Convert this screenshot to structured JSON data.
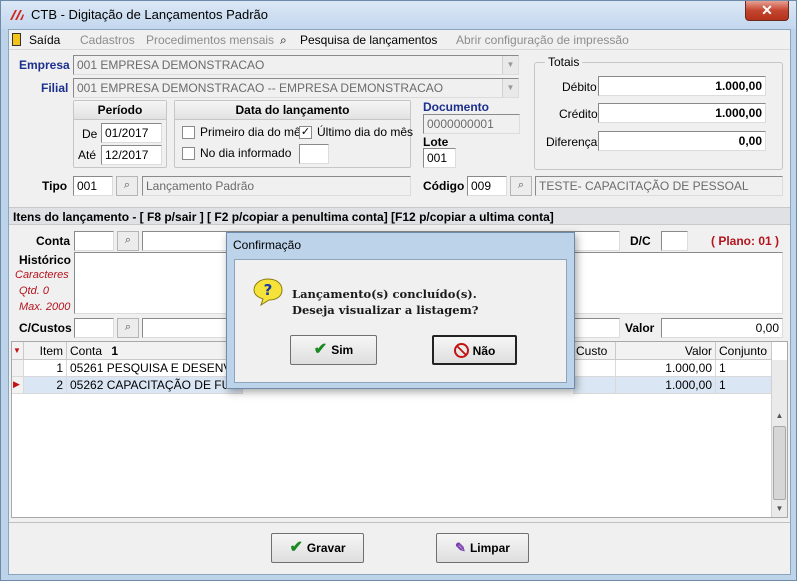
{
  "window": {
    "title": "CTB - Digitação de Lançamentos Padrão",
    "close": "✕"
  },
  "menu": [
    {
      "label": "Saída",
      "enabled": true
    },
    {
      "label": "Cadastros",
      "enabled": false
    },
    {
      "label": "Procedimentos mensais",
      "enabled": false
    },
    {
      "label": "Pesquisa de lançamentos",
      "enabled": true
    },
    {
      "label": "Abrir configuração de impressão",
      "enabled": false
    }
  ],
  "empresa": {
    "label": "Empresa",
    "value": "001 EMPRESA DEMONSTRACAO"
  },
  "filial": {
    "label": "Filial",
    "value": "001 EMPRESA DEMONSTRACAO -- EMPRESA DEMONSTRACAO"
  },
  "periodo": {
    "title": "Período",
    "de_label": "De",
    "de": "01/2017",
    "ate_label": "Até",
    "ate": "12/2017"
  },
  "data_lancamento": {
    "title": "Data do lançamento",
    "primeiro": {
      "label": "Primeiro dia do mês",
      "checked": false
    },
    "ultimo": {
      "label": "Último dia do mês",
      "checked": true
    },
    "no_dia": {
      "label": "No dia informado",
      "checked": false
    },
    "dia": ""
  },
  "documento": {
    "label": "Documento",
    "value": "0000000001"
  },
  "lote": {
    "label": "Lote",
    "value": "001"
  },
  "totais": {
    "title": "Totais",
    "debito_label": "Débito",
    "debito": "1.000,00",
    "credito_label": "Crédito",
    "credito": "1.000,00",
    "diferenca_label": "Diferença",
    "diferenca": "0,00"
  },
  "tipo": {
    "label": "Tipo",
    "code": "001",
    "desc": "Lançamento Padrão"
  },
  "codigo": {
    "label": "Código",
    "code": "009",
    "desc": "TESTE- CAPACITAÇÃO DE PESSOAL"
  },
  "itens_bar": "Itens do lançamento - [ F8 p/sair ]  [ F2 p/copiar a penultima conta]  [F12 p/copiar a ultima conta]",
  "conta": {
    "label": "Conta",
    "code": "",
    "desc": ""
  },
  "dc": {
    "label": "D/C",
    "value": ""
  },
  "plano": "( Plano: 01 )",
  "historico": {
    "label": "Histórico",
    "hint1": "Caracteres",
    "hint2": "Qtd.  0",
    "hint3": "Max. 2000",
    "value": ""
  },
  "ccustos": {
    "label": "C/Custos",
    "code": "",
    "desc": ""
  },
  "valor": {
    "label": "Valor",
    "value": "0,00"
  },
  "grid": {
    "headers": {
      "item": "Item",
      "conta": "Conta",
      "sort": "1",
      "custo": "Custo",
      "valor": "Valor",
      "conjunto": "Conjunto"
    },
    "rows": [
      {
        "item": "1",
        "conta": "05261 PESQUISA E DESENVOLV",
        "valor": "1.000,00",
        "conjunto": "1",
        "selected": false
      },
      {
        "item": "2",
        "conta": "05262 CAPACITAÇÃO DE FUNC",
        "valor": "1.000,00",
        "conjunto": "1",
        "selected": true
      }
    ]
  },
  "buttons": {
    "gravar": "Gravar",
    "limpar": "Limpar"
  },
  "dialog": {
    "title": "Confirmação",
    "line1": "Lançamento(s) concluído(s).",
    "line2": "Deseja visualizar a listagem?",
    "sim": "Sim",
    "nao": "Não"
  }
}
